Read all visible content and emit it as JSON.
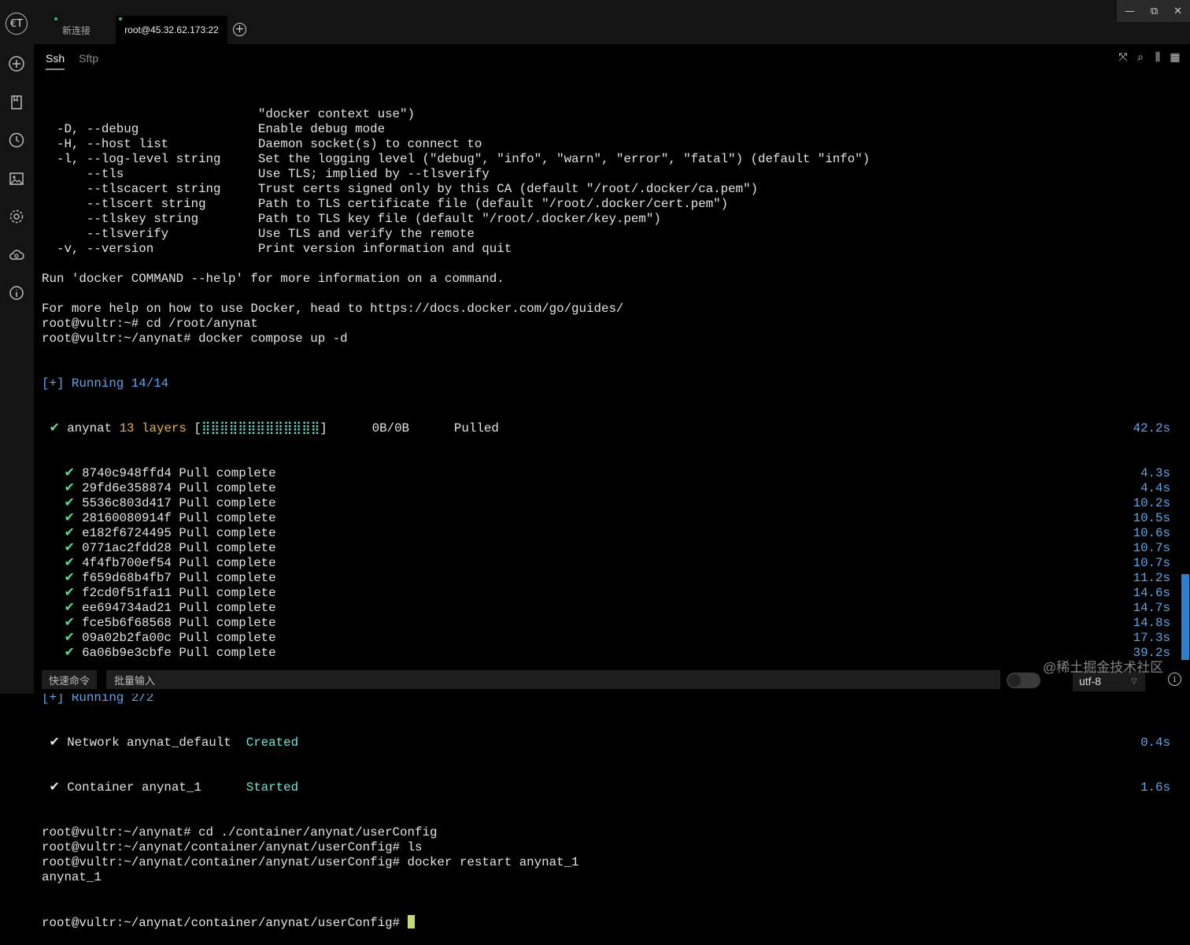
{
  "app": {
    "logo_text": "€T"
  },
  "tabs": [
    {
      "label": "新连接"
    },
    {
      "label": "root@45.32.62.173:22"
    }
  ],
  "add_tab_symbol": "+",
  "window_controls": {
    "minimize": "—",
    "maximize": "⧉",
    "close": "✕"
  },
  "subtabs": [
    {
      "label": "Ssh"
    },
    {
      "label": "Sftp"
    }
  ],
  "terminal": {
    "help_lines": [
      "                             \"docker context use\")",
      "  -D, --debug                Enable debug mode",
      "  -H, --host list            Daemon socket(s) to connect to",
      "  -l, --log-level string     Set the logging level (\"debug\", \"info\", \"warn\", \"error\", \"fatal\") (default \"info\")",
      "      --tls                  Use TLS; implied by --tlsverify",
      "      --tlscacert string     Trust certs signed only by this CA (default \"/root/.docker/ca.pem\")",
      "      --tlscert string       Path to TLS certificate file (default \"/root/.docker/cert.pem\")",
      "      --tlskey string        Path to TLS key file (default \"/root/.docker/key.pem\")",
      "      --tlsverify            Use TLS and verify the remote",
      "  -v, --version              Print version information and quit",
      "",
      "Run 'docker COMMAND --help' for more information on a command.",
      "",
      "For more help on how to use Docker, head to https://docs.docker.com/go/guides/",
      "root@vultr:~# cd /root/anynat",
      "root@vultr:~/anynat# docker compose up -d"
    ],
    "running1": "[+] Running 14/14",
    "anynat_row": {
      "check": " ✔ ",
      "name": "anynat ",
      "layers": "13 layers",
      "bar_open": " [",
      "bar": "⣿⣿⣿⣿⣿⣿⣿⣿⣿⣿⣿⣿⣿",
      "bar_close": "]",
      "rest": "      0B/0B      Pulled",
      "time": "42.2s"
    },
    "pulls": [
      {
        "id": "8740c948ffd4",
        "time": "4.3s"
      },
      {
        "id": "29fd6e358874",
        "time": "4.4s"
      },
      {
        "id": "5536c803d417",
        "time": "10.2s"
      },
      {
        "id": "28160080914f",
        "time": "10.5s"
      },
      {
        "id": "e182f6724495",
        "time": "10.6s"
      },
      {
        "id": "0771ac2fdd28",
        "time": "10.7s"
      },
      {
        "id": "4f4fb700ef54",
        "time": "10.7s"
      },
      {
        "id": "f659d68b4fb7",
        "time": "11.2s"
      },
      {
        "id": "f2cd0f51fa11",
        "time": "14.6s"
      },
      {
        "id": "ee694734ad21",
        "time": "14.7s"
      },
      {
        "id": "fce5b6f68568",
        "time": "14.8s"
      },
      {
        "id": "09a02b2fa00c",
        "time": "17.3s"
      },
      {
        "id": "6a06b9e3cbfe",
        "time": "39.2s"
      }
    ],
    "pull_status": "Pull complete",
    "running2": "[+] Running 2/2",
    "network_row": {
      "label": " ✔ Network anynat_default  ",
      "status": "Created",
      "time": "0.4s"
    },
    "container_row": {
      "label": " ✔ Container anynat_1      ",
      "status": "Started",
      "time": "1.6s"
    },
    "tail_lines": [
      "root@vultr:~/anynat# cd ./container/anynat/userConfig",
      "root@vultr:~/anynat/container/anynat/userConfig# ls",
      "root@vultr:~/anynat/container/anynat/userConfig# docker restart anynat_1",
      "anynat_1"
    ],
    "prompt": "root@vultr:~/anynat/container/anynat/userConfig# "
  },
  "bottom": {
    "quick_cmd": "快速命令",
    "batch_input": "批量输入",
    "encoding": "utf-8",
    "info": "i"
  },
  "watermark": "@稀土掘金技术社区"
}
